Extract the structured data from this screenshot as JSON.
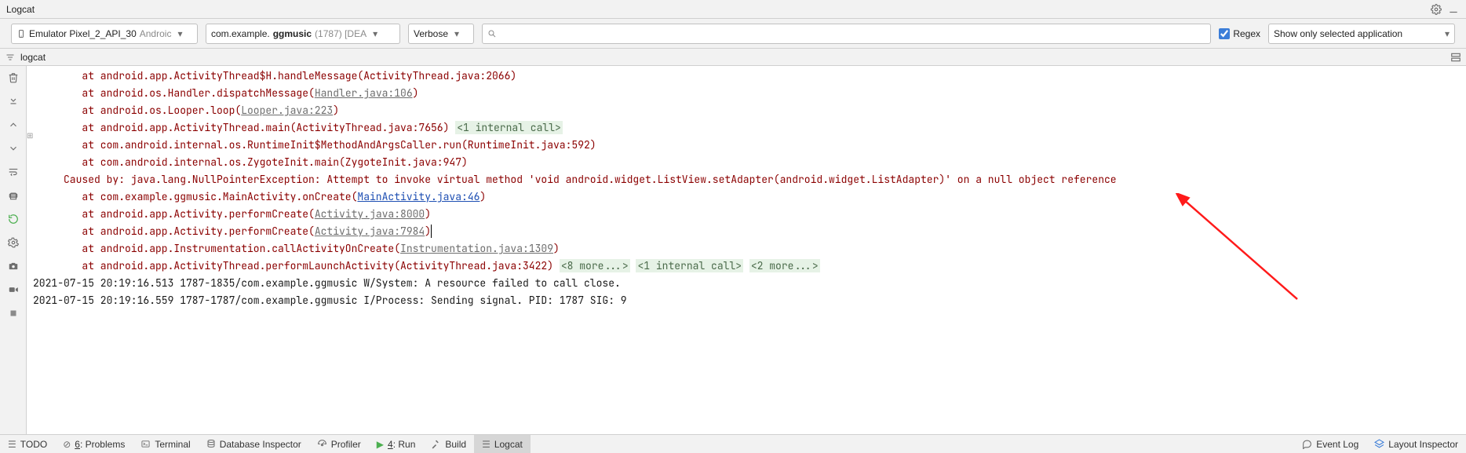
{
  "panel_title": "Logcat",
  "filters": {
    "device_prefix": "Emulator Pixel_2_API_30",
    "device_suffix": "Androic",
    "process_prefix": "com.example.",
    "process_bold": "ggmusic",
    "process_suffix": " (1787) [DEA",
    "level": "Verbose",
    "search_placeholder": "",
    "regex_label": "Regex",
    "regex_checked": true,
    "app_filter": "Show only selected application"
  },
  "subheader": {
    "label": "logcat"
  },
  "log_lines": [
    {
      "indent": 8,
      "red": true,
      "text": "at android.app.ActivityThread$H.handleMessage(ActivityThread.java:2066)"
    },
    {
      "indent": 8,
      "red": true,
      "parts": [
        {
          "t": "at android.os.Handler.dispatchMessage("
        },
        {
          "t": "Handler.java:106",
          "glink": true
        },
        {
          "t": ")"
        }
      ]
    },
    {
      "indent": 8,
      "red": true,
      "parts": [
        {
          "t": "at android.os.Looper.loop("
        },
        {
          "t": "Looper.java:223",
          "glink": true
        },
        {
          "t": ")"
        }
      ]
    },
    {
      "indent": 8,
      "red": true,
      "parts": [
        {
          "t": "at android.app.ActivityThread.main(ActivityThread.java:7656) "
        },
        {
          "t": "<1 internal call>",
          "chip": true
        }
      ]
    },
    {
      "indent": 8,
      "red": true,
      "text": "at com.android.internal.os.RuntimeInit$MethodAndArgsCaller.run(RuntimeInit.java:592)"
    },
    {
      "indent": 8,
      "red": true,
      "text": "at com.android.internal.os.ZygoteInit.main(ZygoteInit.java:947)"
    },
    {
      "indent": 5,
      "red": true,
      "text": "Caused by: java.lang.NullPointerException: Attempt to invoke virtual method 'void android.widget.ListView.setAdapter(android.widget.ListAdapter)' on a null object reference"
    },
    {
      "indent": 8,
      "red": true,
      "parts": [
        {
          "t": "at com.example.ggmusic.MainActivity.onCreate("
        },
        {
          "t": "MainActivity.java:46",
          "link": true
        },
        {
          "t": ")"
        }
      ]
    },
    {
      "indent": 8,
      "red": true,
      "parts": [
        {
          "t": "at android.app.Activity.performCreate("
        },
        {
          "t": "Activity.java:8000",
          "glink": true
        },
        {
          "t": ")"
        }
      ]
    },
    {
      "indent": 8,
      "red": true,
      "parts": [
        {
          "t": "at android.app.Activity.performCreate("
        },
        {
          "t": "Activity.java:7984",
          "glink": true
        },
        {
          "t": ")",
          "cursor": true
        }
      ]
    },
    {
      "indent": 8,
      "red": true,
      "parts": [
        {
          "t": "at android.app.Instrumentation.callActivityOnCreate("
        },
        {
          "t": "Instrumentation.java:1309",
          "glink": true
        },
        {
          "t": ")"
        }
      ]
    },
    {
      "indent": 8,
      "red": true,
      "parts": [
        {
          "t": "at android.app.ActivityThread.performLaunchActivity(ActivityThread.java:3422) "
        },
        {
          "t": "<8 more...>",
          "chip": true
        },
        {
          "t": " "
        },
        {
          "t": "<1 internal call>",
          "chip": true
        },
        {
          "t": " "
        },
        {
          "t": "<2 more...>",
          "chip": true
        }
      ]
    },
    {
      "indent": 0,
      "red": false,
      "text": "2021-07-15 20:19:16.513 1787-1835/com.example.ggmusic W/System: A resource failed to call close."
    },
    {
      "indent": 0,
      "red": false,
      "text": "2021-07-15 20:19:16.559 1787-1787/com.example.ggmusic I/Process: Sending signal. PID: 1787 SIG: 9"
    }
  ],
  "status": {
    "todo": "TODO",
    "problems_key": "6",
    "problems_suffix": ": Problems",
    "terminal": "Terminal",
    "db": "Database Inspector",
    "profiler": "Profiler",
    "run_key": "4",
    "run_suffix": ": Run",
    "build": "Build",
    "logcat": "Logcat",
    "event_log": "Event Log",
    "layout_inspector": "Layout Inspector"
  }
}
